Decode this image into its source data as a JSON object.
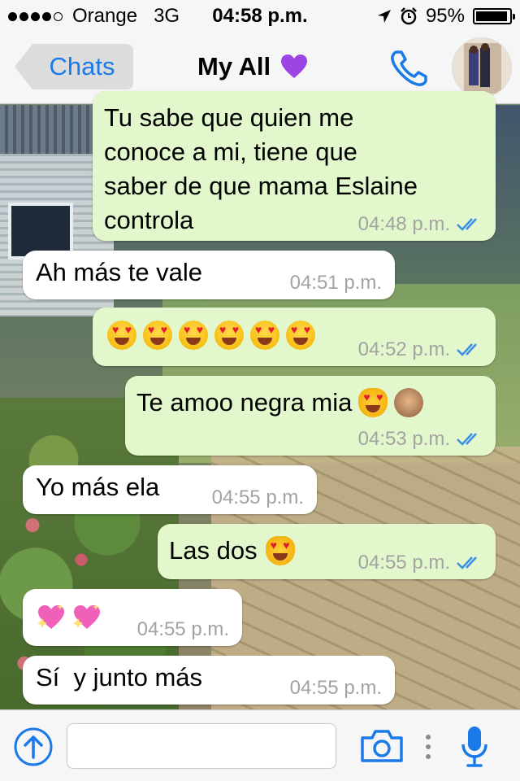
{
  "status_bar": {
    "carrier": "Orange",
    "network": "3G",
    "time": "04:58 p.m.",
    "battery": "95%",
    "battery_level": 0.95,
    "signal_bars_filled": 4,
    "signal_bars_total": 5
  },
  "nav": {
    "back_label": "Chats",
    "title": "My All",
    "title_emoji": "purple-heart-icon",
    "accent_color": "#1a7ae8"
  },
  "messages": [
    {
      "direction": "out",
      "text": "Tu sabe que quien me\nconoce a mi, tiene que\nsaber de que mama Eslaine\ncontrola",
      "time": "04:48 p.m.",
      "read": true
    },
    {
      "direction": "in",
      "text": "Ah más te vale",
      "time": "04:51 p.m."
    },
    {
      "direction": "out",
      "emojis": [
        "heart-eyes-face-icon",
        "heart-eyes-face-icon",
        "heart-eyes-face-icon",
        "heart-eyes-face-icon",
        "heart-eyes-face-icon",
        "heart-eyes-face-icon"
      ],
      "time": "04:52 p.m.",
      "read": true
    },
    {
      "direction": "out",
      "text": "Te amoo negra mia",
      "emojis": [
        "heart-eyes-cat-icon",
        "see-no-evil-monkey-icon"
      ],
      "time": "04:53 p.m.",
      "read": true
    },
    {
      "direction": "in",
      "text": "Yo más ela",
      "time": "04:55 p.m."
    },
    {
      "direction": "out",
      "text": "Las dos",
      "emojis": [
        "heart-eyes-cat-icon"
      ],
      "time": "04:55 p.m.",
      "read": true
    },
    {
      "direction": "in",
      "emojis": [
        "sparkling-heart-icon",
        "sparkling-heart-icon"
      ],
      "time": "04:55 p.m."
    },
    {
      "direction": "in",
      "text": "Sí  y junto más",
      "time": "04:55 p.m."
    }
  ],
  "input": {
    "value": "",
    "placeholder": ""
  },
  "colors": {
    "outgoing_bubble": "#e2f7cb",
    "incoming_bubble": "#ffffff",
    "read_ticks": "#3a8ee6",
    "timestamp": "#a3a3a3"
  }
}
